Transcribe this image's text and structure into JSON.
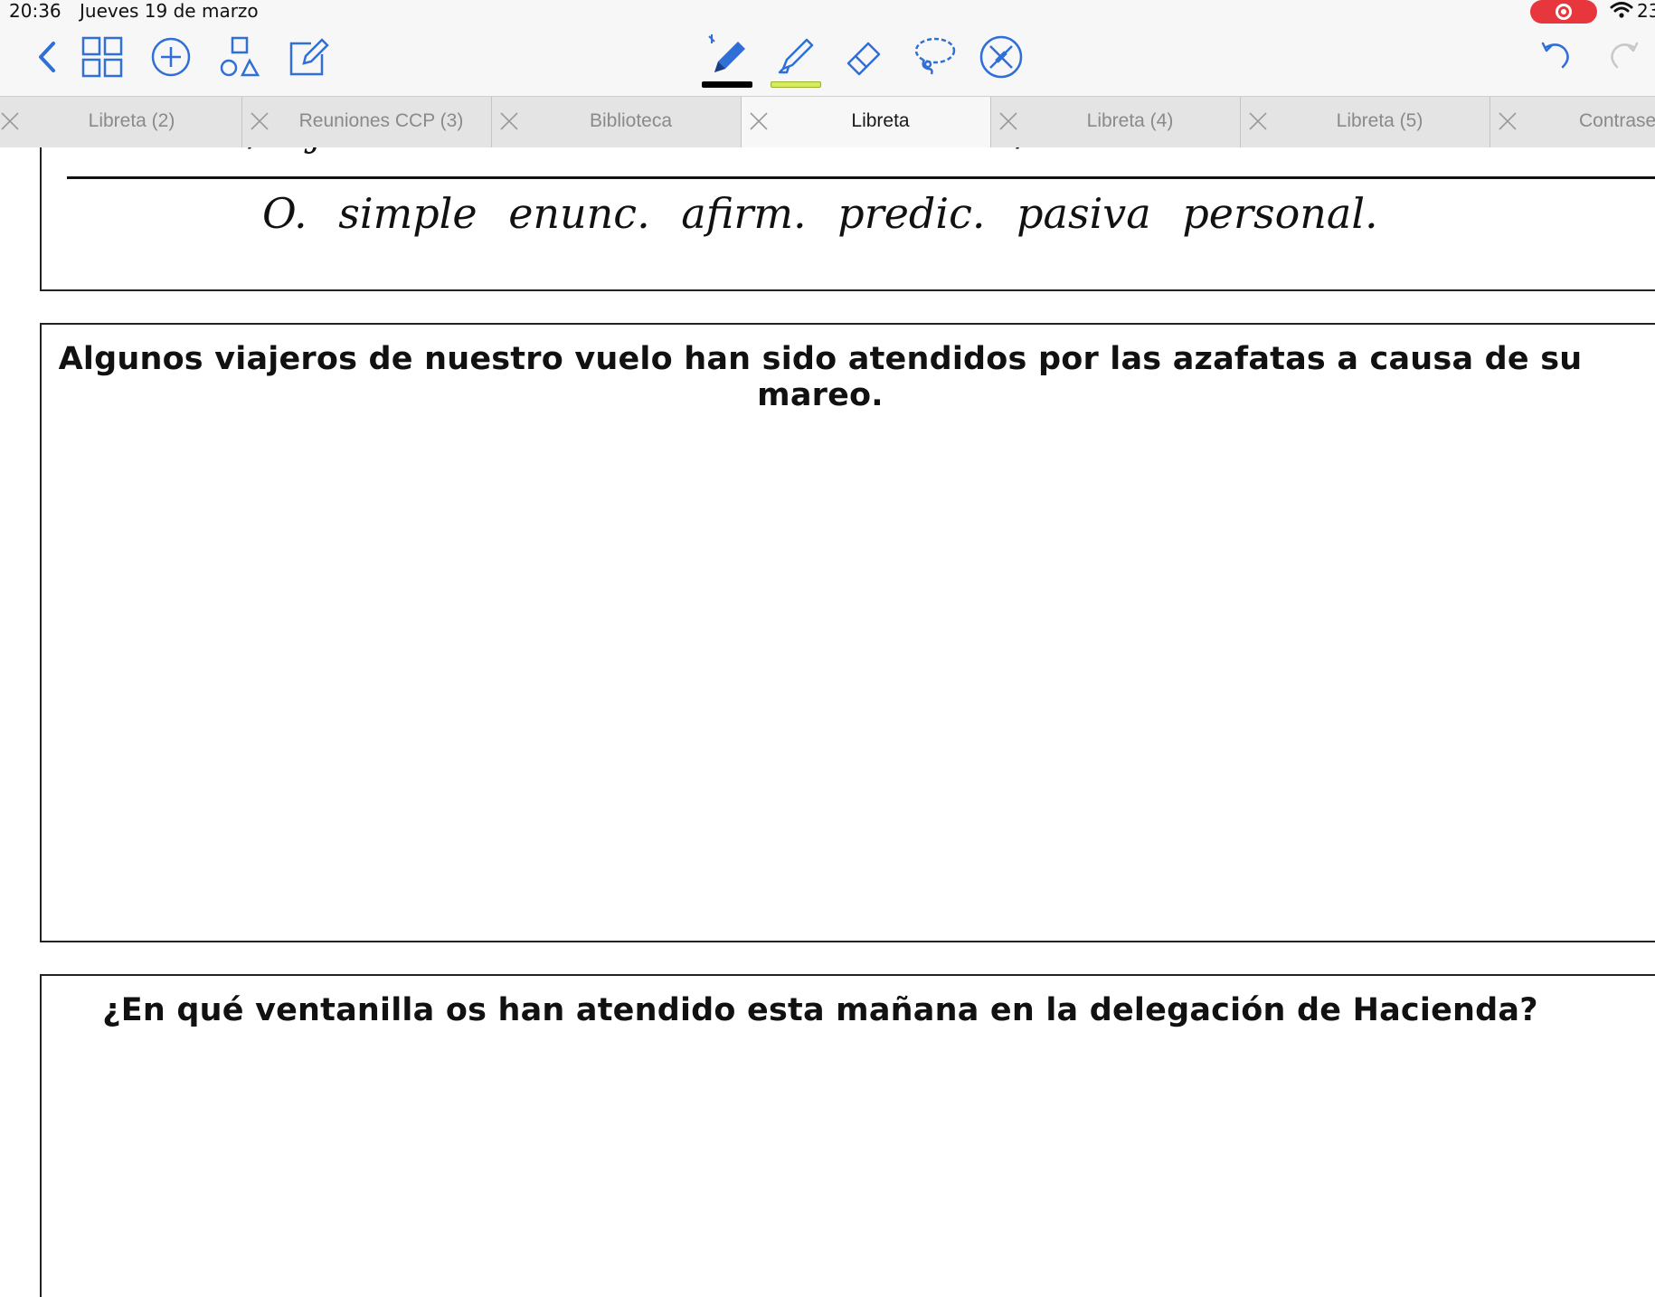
{
  "status_bar": {
    "time": "20:36",
    "date": "Jueves 19 de marzo",
    "battery": "23"
  },
  "toolbar": {
    "left_tools": [
      "back-icon",
      "grid-icon",
      "add-icon",
      "shapes-icon",
      "edit-icon"
    ],
    "center_tools": [
      "pen-icon",
      "highlighter-icon",
      "eraser-icon",
      "lasso-icon",
      "hide-tools-icon"
    ],
    "right_tools": [
      "undo-icon",
      "redo-icon"
    ],
    "pen_color": "#000000",
    "highlighter_color": "#d7ec5a",
    "accent_color": "#2f6fd6"
  },
  "tabs": [
    {
      "label": "Libreta (2)",
      "active": false
    },
    {
      "label": "Reuniones CCP (3)",
      "active": false
    },
    {
      "label": "Biblioteca",
      "active": false
    },
    {
      "label": "Libreta",
      "active": true
    },
    {
      "label": "Libreta (4)",
      "active": false
    },
    {
      "label": "Libreta (5)",
      "active": false
    },
    {
      "label": "Contrase",
      "active": false
    }
  ],
  "document": {
    "top_handwriting": {
      "left_fragment": "SU/Suj.",
      "right_fragment": "SV/PV",
      "analysis": "O. simple enunc. afirm. predic. pasiva personal."
    },
    "exercises": [
      {
        "sentence": "Algunos viajeros de nuestro vuelo han sido atendidos por las azafatas a causa de su mareo."
      },
      {
        "sentence": "¿En qué ventanilla os han atendido esta mañana en la delegación de Hacienda?"
      }
    ]
  }
}
